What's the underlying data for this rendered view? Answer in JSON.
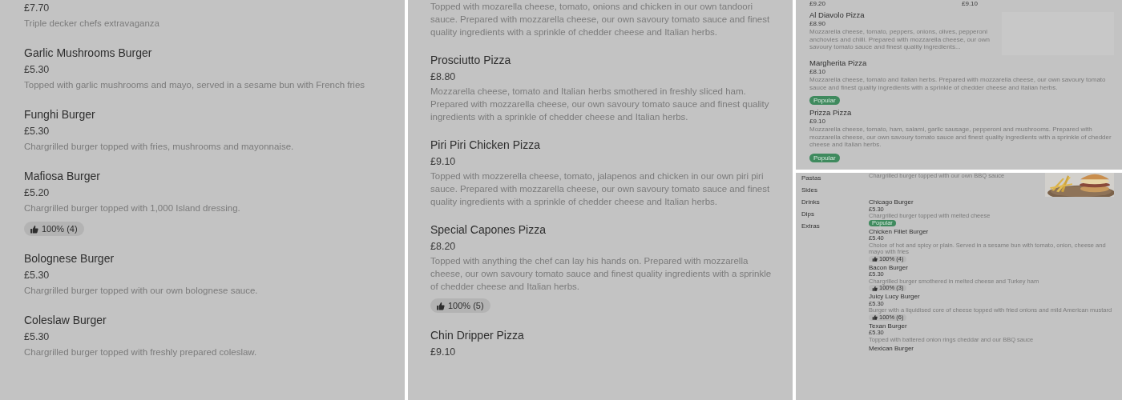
{
  "left_panel": {
    "items": [
      {
        "price": "£7.70",
        "description": "Triple decker chefs extravaganza"
      },
      {
        "name": "Garlic Mushrooms Burger",
        "price": "£5.30",
        "description": "Topped with garlic mushrooms and mayo, served in a sesame bun with French fries"
      },
      {
        "name": "Funghi Burger",
        "price": "£5.30",
        "description": "Chargrilled burger topped with fries, mushrooms and mayonnaise."
      },
      {
        "name": "Mafiosa Burger",
        "price": "£5.20",
        "description": "Chargrilled burger topped with 1,000 Island dressing.",
        "rating": "100% (4)"
      },
      {
        "name": "Bolognese Burger",
        "price": "£5.30",
        "description": "Chargrilled burger topped with our own bolognese sauce."
      },
      {
        "name": "Coleslaw Burger",
        "price": "£5.30",
        "description": "Chargrilled burger topped with freshly prepared coleslaw."
      }
    ]
  },
  "middle_panel": {
    "items": [
      {
        "description": "Topped with mozarella cheese, tomato, onions and chicken in our own tandoori sauce. Prepared with mozzarella cheese, our own savoury tomato sauce and finest quality ingredients with a sprinkle of chedder cheese and Italian herbs."
      },
      {
        "name": "Prosciutto Pizza",
        "price": "£8.80",
        "description": "Mozzarella cheese, tomato and Italian herbs smothered in freshly sliced ham. Prepared with mozzarella cheese, our own savoury tomato sauce and finest quality ingredients with a sprinkle of chedder cheese and Italian herbs."
      },
      {
        "name": "Piri Piri Chicken Pizza",
        "price": "£9.10",
        "description": "Topped with mozzerella cheese, tomato, jalapenos and chicken in our own piri piri sauce. Prepared with mozzarella cheese, our own savoury tomato sauce and finest quality ingredients with a sprinkle of chedder cheese and Italian herbs."
      },
      {
        "name": "Special Capones Pizza",
        "price": "£8.20",
        "description": "Topped with anything the chef can lay his hands on. Prepared with mozzarella cheese, our own savoury tomato sauce and finest quality ingredients with a sprinkle of chedder cheese and Italian herbs.",
        "rating": "100% (5)"
      },
      {
        "name": "Chin Dripper Pizza",
        "price": "£9.10"
      }
    ]
  },
  "right_top_panel": {
    "prices": [
      "£9.20",
      "£9.10"
    ],
    "items": [
      {
        "name": "Al Diavolo Pizza",
        "price": "£8.90",
        "description": "Mozzarella cheese, tomato, peppers, onions, olives, pepperoni anchovies and chilli. Prepared with mozzarella cheese, our own savoury tomato sauce and finest quality ingredients...",
        "thumbnail": {
          "kind": "placeholder"
        }
      },
      {
        "name": "Margherita Pizza",
        "price": "£8.10",
        "description": "Mozzarella cheese, tomato and Italian herbs. Prepared with mozzarella cheese, our own savoury tomato sauce and finest quality ingredients with a sprinkle of chedder cheese and Italian herbs.",
        "badge": "Popular"
      },
      {
        "name": "Prizza Pizza",
        "price": "£9.10",
        "description": "Mozzarella cheese, tomato, ham, salami, garlic sausage, pepperoni and mushrooms. Prepared with mozzarella cheese, our own savoury tomato sauce and finest quality ingredients with a sprinkle of chedder cheese and Italian herbs.",
        "badge": "Popular"
      }
    ]
  },
  "right_bottom_panel": {
    "categories": [
      "Pastas",
      "Sides",
      "Drinks",
      "Dips",
      "Extras"
    ],
    "items": [
      {
        "description": "Chargrilled burger topped with our own BBQ sauce"
      },
      {
        "name": "Chicago Burger",
        "price": "£5.30",
        "description": "Chargrilled burger topped with melted cheese",
        "badge": "Popular"
      },
      {
        "name": "Chicken Fillet Burger",
        "price": "£5.40",
        "description": "Choice of hot and spicy or plain. Served in a sesame bun with tomato, onion, cheese and mayo with fries",
        "rating": "100% (4)"
      },
      {
        "name": "Bacon Burger",
        "price": "£5.30",
        "description": "Chargrilled burger smothered in melted cheese and Turkey ham",
        "rating": "100% (3)"
      },
      {
        "name": "Juicy Lucy Burger",
        "price": "£5.30",
        "description": "Burger with a liquidised core of cheese topped with fried onions and mild American mustard",
        "rating": "100% (6)"
      },
      {
        "name": "Texan Burger",
        "price": "£5.30",
        "description": "Topped with battered onion rings cheddar and our BBQ sauce"
      },
      {
        "name": "Mexican Burger"
      }
    ]
  }
}
